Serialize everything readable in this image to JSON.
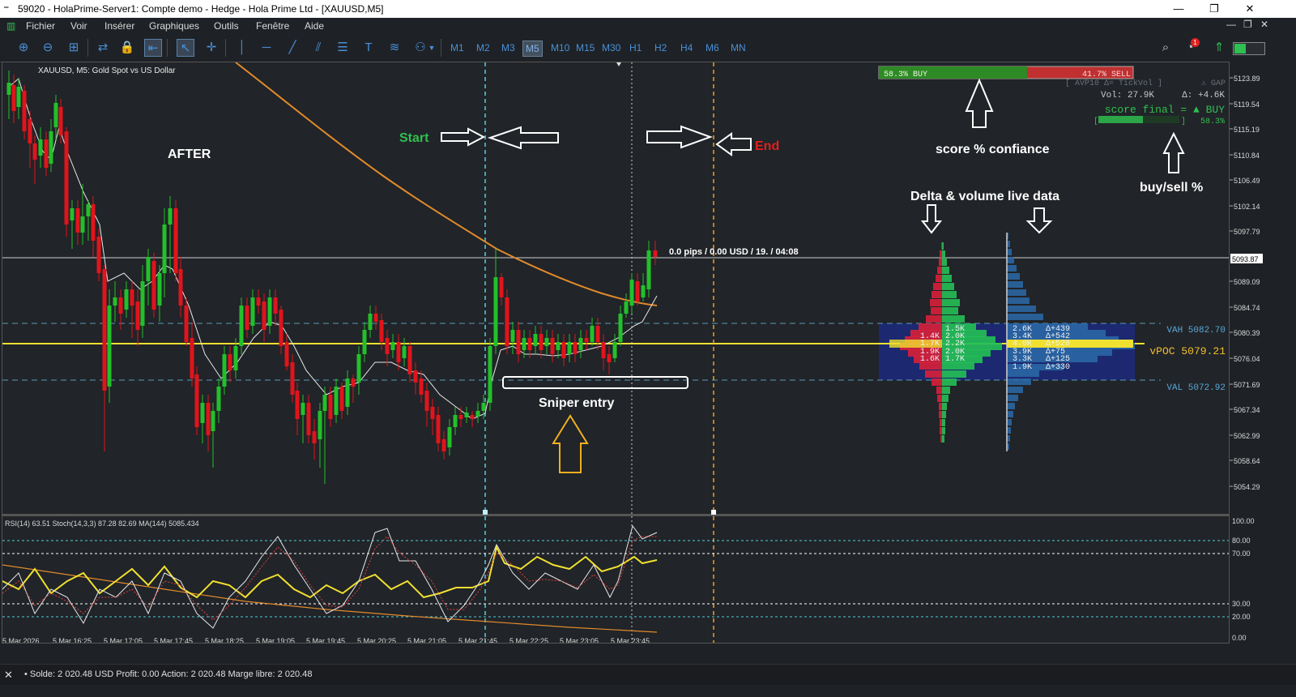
{
  "window": {
    "title": "59020 - HolaPrime-Server1: Compte demo - Hedge - Hola Prime Ltd - [XAUUSD,M5]",
    "minimize": "—",
    "maximize": "❐",
    "close": "✕"
  },
  "menu": [
    "Fichier",
    "Voir",
    "Insérer",
    "Graphiques",
    "Outils",
    "Fenêtre",
    "Aide"
  ],
  "timeframes": [
    "M1",
    "M2",
    "M3",
    "M5",
    "M10",
    "M15",
    "M30",
    "H1",
    "H2",
    "H4",
    "M6",
    "MN"
  ],
  "active_timeframe": "M5",
  "chart": {
    "symbol_label": "XAUUSD, M5:  Gold Spot vs US Dollar",
    "current_price": "5093.87",
    "price_levels": [
      "5123.89",
      "5119.54",
      "5115.19",
      "5110.84",
      "5106.49",
      "5102.14",
      "5097.79",
      "5093.87",
      "5089.09",
      "5084.74",
      "5080.39",
      "5076.04",
      "5071.69",
      "5067.34",
      "5062.99",
      "5058.64",
      "5054.29"
    ],
    "time_labels": [
      "5 Mar 2026",
      "5 Mar 16:25",
      "5 Mar 17:05",
      "5 Mar 17:45",
      "5 Mar 18:25",
      "5 Mar 19:05",
      "5 Mar 19:45",
      "5 Mar 20:25",
      "5 Mar 21:05",
      "5 Mar 21:45",
      "5 Mar 22:25",
      "5 Mar 23:05",
      "5 Mar 23:45"
    ],
    "pips_label": "0.0 pips / 0.00 USD / 19. / 04:08",
    "annotations": {
      "after": "AFTER",
      "start": "Start",
      "end": "End",
      "sniper_entry": "Sniper entry",
      "score_confidence": "score % confiance",
      "delta_volume": "Delta & volume live data",
      "buy_sell_pct": "buy/sell %"
    },
    "colors": {
      "bull": "#22c02a",
      "bear": "#e0141c",
      "ma_orange": "#e08a2c",
      "poc_yellow": "#f0e030",
      "start_line": "#4fd0e0",
      "end_line": "#f0a020"
    }
  },
  "panel": {
    "buy_pct": "58.3% BUY",
    "sell_pct": "41.7% SELL",
    "buy_fraction": 0.583,
    "avp_label": "[ AVP10  Δ= TickVol ]",
    "gap_label": "⚠ GAP",
    "vol_label": "Vol: 27.9K",
    "delta_label": "Δ: +4.6K",
    "score_label": "score final = ▲ BUY",
    "score_value": "58.3%"
  },
  "volume_profile": {
    "vah": "VAH 5082.70",
    "vpoc": "vPOC 5079.21",
    "val": "VAL 5072.92",
    "rows": [
      {
        "sell": "",
        "buy": "1.5K",
        "vol": "2.6K",
        "delta": "Δ+439"
      },
      {
        "sell": "1.4K",
        "buy": "2.0K",
        "vol": "3.4K",
        "delta": "Δ+542"
      },
      {
        "sell": "1.7K",
        "buy": "2.2K",
        "vol": "4.0K",
        "delta": "Δ+520"
      },
      {
        "sell": "1.9K",
        "buy": "2.0K",
        "vol": "3.9K",
        "delta": "Δ+75"
      },
      {
        "sell": "1.6K",
        "buy": "1.7K",
        "vol": "3.3K",
        "delta": "Δ+125"
      },
      {
        "sell": "",
        "buy": "",
        "vol": "1.9K",
        "delta": "Δ+330"
      }
    ]
  },
  "indicator": {
    "label": "RSI(14) 63.51 Stoch(14,3,3) 87.28 82.69 MA(144) 5085.434",
    "levels": [
      "100.00",
      "80.00",
      "70.00",
      "30.00",
      "20.00",
      "0.00"
    ]
  },
  "status": {
    "close": "✕",
    "text": "• Solde: 2 020.48 USD  Profit: 0.00  Action: 2 020.48  Marge libre: 2 020.48"
  }
}
